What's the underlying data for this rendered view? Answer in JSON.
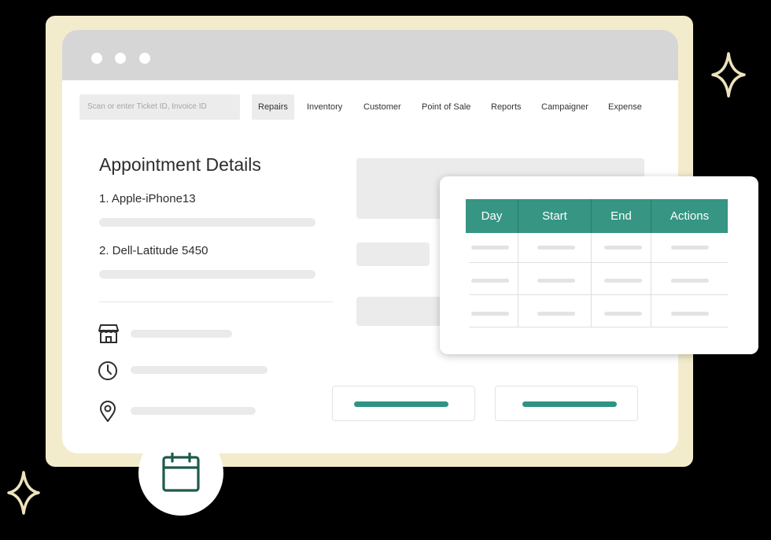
{
  "search": {
    "placeholder": "Scan or enter Ticket ID, Invoice ID"
  },
  "nav": [
    "Repairs",
    "Inventory",
    "Customer",
    "Point of Sale",
    "Reports",
    "Campaigner",
    "Expense"
  ],
  "details": {
    "title": "Appointment Details",
    "items": [
      "1. Apple-iPhone13",
      "2. Dell-Latitude 5450"
    ],
    "icons": [
      "store-icon",
      "clock-icon",
      "location-pin-icon"
    ]
  },
  "schedule_table": {
    "columns": [
      "Day",
      "Start",
      "End",
      "Actions"
    ]
  },
  "floating_icon": "calendar-icon",
  "colors": {
    "accent": "#369583",
    "frame": "#f3eccc",
    "sparkle": "#eee3bd"
  }
}
